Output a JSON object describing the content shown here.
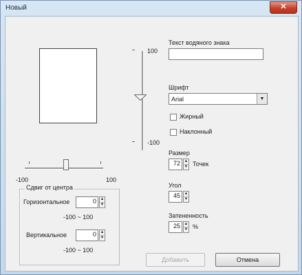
{
  "window": {
    "title": "Новый",
    "close_glyph": "✕"
  },
  "preview": {},
  "vertical_slider": {
    "top_label": "100",
    "bottom_label": "-100"
  },
  "horizontal_slider": {
    "left_label": "-100",
    "right_label": "100"
  },
  "offset_group": {
    "title": "Сдвиг от центра",
    "horizontal": {
      "label": "Горизонтальное",
      "value": "0",
      "range": "-100 ~ 100"
    },
    "vertical": {
      "label": "Вертикальное",
      "value": "0",
      "range": "-100 ~ 100"
    }
  },
  "watermark": {
    "label": "Текст водяного знака",
    "value": ""
  },
  "font": {
    "label": "Шрифт",
    "value": "Arial"
  },
  "bold": {
    "label": "Жирный",
    "checked": false
  },
  "italic": {
    "label": "Наклонный",
    "checked": false
  },
  "size": {
    "label": "Размер",
    "value": "72",
    "unit": "Точек"
  },
  "angle": {
    "label": "Угол",
    "value": "45"
  },
  "shading": {
    "label": "Затененность",
    "value": "25",
    "unit": "%"
  },
  "buttons": {
    "add": "Добавить",
    "cancel": "Отмена"
  }
}
